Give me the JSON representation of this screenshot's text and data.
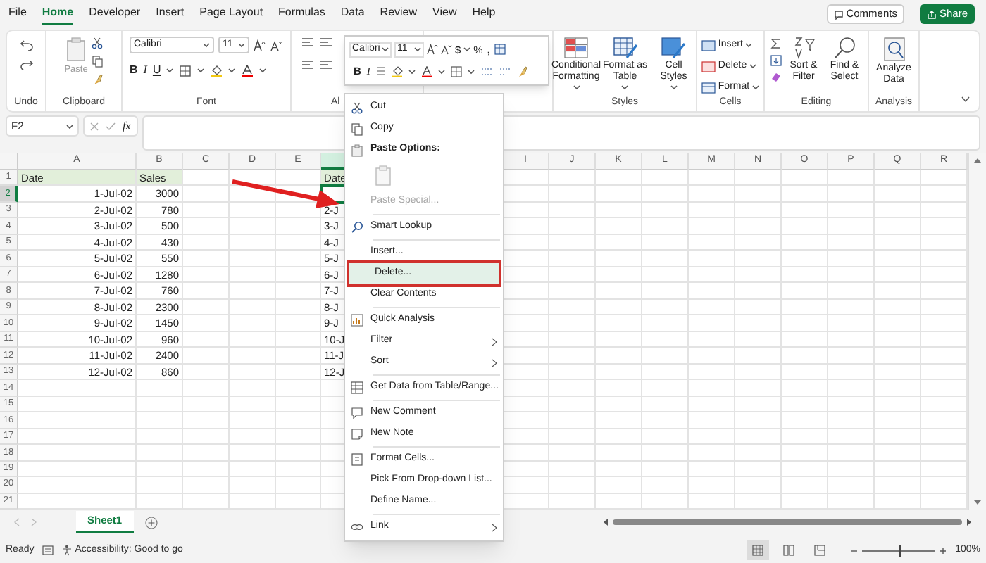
{
  "menu_tabs": [
    {
      "label": "File",
      "selected": false
    },
    {
      "label": "Home",
      "selected": true
    },
    {
      "label": "Developer",
      "selected": false
    },
    {
      "label": "Insert",
      "selected": false
    },
    {
      "label": "Page Layout",
      "selected": false
    },
    {
      "label": "Formulas",
      "selected": false
    },
    {
      "label": "Data",
      "selected": false
    },
    {
      "label": "Review",
      "selected": false
    },
    {
      "label": "View",
      "selected": false
    },
    {
      "label": "Help",
      "selected": false
    }
  ],
  "header_buttons": {
    "comments": "Comments",
    "share": "Share"
  },
  "ribbon": {
    "groups": [
      {
        "kind": "undo",
        "label": "Undo"
      },
      {
        "kind": "clipboard",
        "label": "Clipboard",
        "paste": "Paste"
      },
      {
        "kind": "font",
        "label": "Font",
        "font": "Calibri",
        "size": "11",
        "bold": "B",
        "italic": "I",
        "underline": "U"
      },
      {
        "kind": "alignment",
        "label": "Al"
      },
      {
        "kind": "number"
      },
      {
        "kind": "styles",
        "label": "Styles",
        "buttons": [
          "Conditional Formatting",
          "Format as Table",
          "Cell Styles"
        ]
      },
      {
        "kind": "cells",
        "label": "Cells",
        "buttons": [
          "Insert",
          "Delete",
          "Format"
        ]
      },
      {
        "kind": "editing",
        "label": "Editing",
        "buttons": [
          "Sort & Filter",
          "Find & Select"
        ]
      },
      {
        "kind": "analysis",
        "label": "Analysis",
        "buttons": [
          "Analyze Data"
        ]
      }
    ]
  },
  "mini_toolbar": {
    "font": "Calibri",
    "size": "11",
    "dollar": "$",
    "percent": "%",
    "comma": ",",
    "bold": "B",
    "italic": "I"
  },
  "formula_bar": {
    "name_box": "F2",
    "function_label": "fx"
  },
  "columns": [
    {
      "label": "A",
      "selected": false
    },
    {
      "label": "B",
      "selected": false
    },
    {
      "label": "C",
      "selected": false
    },
    {
      "label": "D",
      "selected": false
    },
    {
      "label": "E",
      "selected": false
    },
    {
      "selected": true
    },
    {
      "label": "I",
      "selected": false
    },
    {
      "label": "J",
      "selected": false
    },
    {
      "label": "K",
      "selected": false
    },
    {
      "label": "L",
      "selected": false
    },
    {
      "label": "M",
      "selected": false
    },
    {
      "label": "N",
      "selected": false
    },
    {
      "label": "O",
      "selected": false
    },
    {
      "label": "P",
      "selected": false
    },
    {
      "label": "Q",
      "selected": false
    },
    {
      "label": "R",
      "selected": false
    }
  ],
  "rows": [
    {
      "number": "1",
      "kind": "header",
      "selected": false,
      "a": "Date",
      "b": "Sales",
      "f": "Date"
    },
    {
      "number": "2",
      "kind": "data",
      "selected": true,
      "a": "1-Jul-02",
      "b": "3000"
    },
    {
      "number": "3",
      "kind": "data",
      "selected": false,
      "a": "2-Jul-02",
      "b": "780",
      "f": "2-J"
    },
    {
      "number": "4",
      "kind": "data",
      "selected": false,
      "a": "3-Jul-02",
      "b": "500",
      "f": "3-J"
    },
    {
      "number": "5",
      "kind": "data",
      "selected": false,
      "a": "4-Jul-02",
      "b": "430",
      "f": "4-J"
    },
    {
      "number": "6",
      "kind": "data",
      "selected": false,
      "a": "5-Jul-02",
      "b": "550",
      "f": "5-J"
    },
    {
      "number": "7",
      "kind": "data",
      "selected": false,
      "a": "6-Jul-02",
      "b": "1280",
      "f": "6-J"
    },
    {
      "number": "8",
      "kind": "data",
      "selected": false,
      "a": "7-Jul-02",
      "b": "760",
      "f": "7-J"
    },
    {
      "number": "9",
      "kind": "data",
      "selected": false,
      "a": "8-Jul-02",
      "b": "2300",
      "f": "8-J"
    },
    {
      "number": "10",
      "kind": "data",
      "selected": false,
      "a": "9-Jul-02",
      "b": "1450",
      "f": "9-J"
    },
    {
      "number": "11",
      "kind": "data",
      "selected": false,
      "a": "10-Jul-02",
      "b": "960",
      "f": "10-J"
    },
    {
      "number": "12",
      "kind": "data",
      "selected": false,
      "a": "11-Jul-02",
      "b": "2400",
      "f": "11-J"
    },
    {
      "number": "13",
      "kind": "data",
      "selected": false,
      "a": "12-Jul-02",
      "b": "860",
      "f": "12-J"
    },
    {
      "number": "14",
      "kind": "data",
      "selected": false
    },
    {
      "number": "15",
      "kind": "data",
      "selected": false
    },
    {
      "number": "16",
      "kind": "data",
      "selected": false
    },
    {
      "number": "17",
      "kind": "data",
      "selected": false
    },
    {
      "number": "18",
      "kind": "data",
      "selected": false
    },
    {
      "number": "19",
      "kind": "data",
      "selected": false
    },
    {
      "number": "20",
      "kind": "data",
      "selected": false
    },
    {
      "number": "21",
      "kind": "data",
      "selected": false
    }
  ],
  "context_menu": {
    "items": [
      {
        "kind": "item",
        "label": "Cut",
        "disabled": false,
        "selected": false,
        "submenu": false
      },
      {
        "kind": "item",
        "label": "Copy",
        "disabled": false,
        "selected": false,
        "submenu": false
      },
      {
        "kind": "header",
        "label": "Paste Options:"
      },
      {
        "kind": "paste-icons",
        "disabled": true
      },
      {
        "kind": "item",
        "label": "Paste Special...",
        "disabled": true,
        "selected": false,
        "submenu": false
      },
      {
        "kind": "separator"
      },
      {
        "kind": "item",
        "label": "Smart Lookup",
        "disabled": false,
        "selected": false,
        "submenu": false
      },
      {
        "kind": "separator"
      },
      {
        "kind": "item",
        "label": "Insert...",
        "disabled": false,
        "selected": false,
        "submenu": false
      },
      {
        "kind": "item",
        "label": "Delete...",
        "disabled": false,
        "selected": true,
        "submenu": false
      },
      {
        "kind": "item",
        "label": "Clear Contents",
        "disabled": false,
        "selected": false,
        "submenu": false
      },
      {
        "kind": "separator"
      },
      {
        "kind": "item",
        "label": "Quick Analysis",
        "disabled": false,
        "selected": false,
        "submenu": false
      },
      {
        "kind": "item",
        "label": "Filter",
        "disabled": false,
        "selected": false,
        "submenu": true
      },
      {
        "kind": "item",
        "label": "Sort",
        "disabled": false,
        "selected": false,
        "submenu": true
      },
      {
        "kind": "separator"
      },
      {
        "kind": "item",
        "label": "Get Data from Table/Range...",
        "disabled": false,
        "selected": false,
        "submenu": false
      },
      {
        "kind": "separator"
      },
      {
        "kind": "item",
        "label": "New Comment",
        "disabled": false,
        "selected": false,
        "submenu": false
      },
      {
        "kind": "item",
        "label": "New Note",
        "disabled": false,
        "selected": false,
        "submenu": false
      },
      {
        "kind": "separator"
      },
      {
        "kind": "item",
        "label": "Format Cells...",
        "disabled": false,
        "selected": false,
        "submenu": false
      },
      {
        "kind": "item",
        "label": "Pick From Drop-down List...",
        "disabled": false,
        "selected": false,
        "submenu": false
      },
      {
        "kind": "item",
        "label": "Define Name...",
        "disabled": false,
        "selected": false,
        "submenu": false
      },
      {
        "kind": "separator"
      },
      {
        "kind": "item",
        "label": "Link",
        "disabled": false,
        "selected": false,
        "submenu": true
      }
    ]
  },
  "sheet_tabs": [
    {
      "label": "Sheet1",
      "selected": true
    }
  ],
  "status_bar": {
    "ready": "Ready",
    "accessibility": "Accessibility: Good to go",
    "views": [
      {
        "selected": true
      },
      {
        "selected": false
      },
      {
        "selected": false
      }
    ],
    "zoom": {
      "level": 0.5,
      "reading": "100%"
    }
  }
}
